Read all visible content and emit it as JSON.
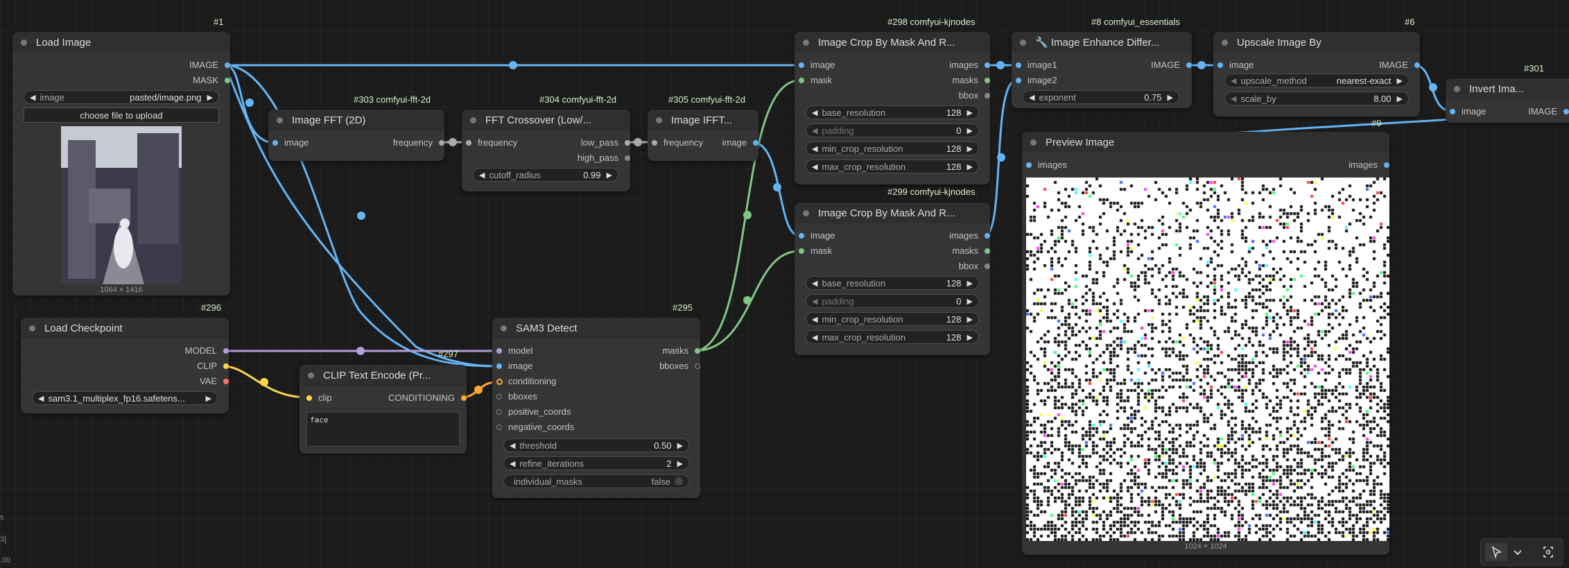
{
  "badges": {
    "n1": "#1",
    "n296": "#296",
    "n297": "#297",
    "n303": "#303 comfyui-fft-2d",
    "n304": "#304 comfyui-fft-2d",
    "n305": "#305 comfyui-fft-2d",
    "n295": "#295",
    "n298": "#298 comfyui-kjnodes",
    "n299": "#299 comfyui-kjnodes",
    "n8": "#8 comfyui_essentials",
    "n6": "#6",
    "n301": "#301",
    "n9": "#9"
  },
  "load_image": {
    "title": "Load Image",
    "out_image": "IMAGE",
    "out_mask": "MASK",
    "widget_label": "image",
    "widget_value": "pasted/image.png",
    "upload_button": "choose file to upload",
    "size_caption": "1064 × 1416"
  },
  "load_checkpoint": {
    "title": "Load Checkpoint",
    "out_model": "MODEL",
    "out_clip": "CLIP",
    "out_vae": "VAE",
    "ckpt_value": "sam3.1_multiplex_fp16.safetens..."
  },
  "clip_text_encode": {
    "title": "CLIP Text Encode (Pr...",
    "in_clip": "clip",
    "out_conditioning": "CONDITIONING",
    "text": "face"
  },
  "fft": {
    "title": "Image FFT (2D)",
    "in_image": "image",
    "out_frequency": "frequency"
  },
  "fft_crossover": {
    "title": "FFT Crossover (Low/...",
    "in_frequency": "frequency",
    "out_low": "low_pass",
    "out_high": "high_pass",
    "cutoff_label": "cutoff_radius",
    "cutoff_value": "0.99"
  },
  "ifft": {
    "title": "Image IFFT...",
    "in_frequency": "frequency",
    "out_image": "image"
  },
  "sam3": {
    "title": "SAM3 Detect",
    "in_model": "model",
    "in_image": "image",
    "in_conditioning": "conditioning",
    "in_bboxes": "bboxes",
    "in_pos": "positive_coords",
    "in_neg": "negative_coords",
    "out_masks": "masks",
    "out_bboxes": "bboxes",
    "threshold_label": "threshold",
    "threshold_value": "0.50",
    "refine_label": "refine_iterations",
    "refine_value": "2",
    "individual_label": "individual_masks",
    "individual_value": "false"
  },
  "crop1": {
    "title": "Image Crop By Mask And R...",
    "in_image": "image",
    "in_mask": "mask",
    "out_images": "images",
    "out_masks": "masks",
    "out_bbox": "bbox",
    "w1_label": "base_resolution",
    "w1_value": "128",
    "w2_label": "padding",
    "w2_value": "0",
    "w3_label": "min_crop_resolution",
    "w3_value": "128",
    "w4_label": "max_crop_resolution",
    "w4_value": "128"
  },
  "crop2": {
    "title": "Image Crop By Mask And R...",
    "in_image": "image",
    "in_mask": "mask",
    "out_images": "images",
    "out_masks": "masks",
    "out_bbox": "bbox",
    "w1_label": "base_resolution",
    "w1_value": "128",
    "w2_label": "padding",
    "w2_value": "0",
    "w3_label": "min_crop_resolution",
    "w3_value": "128",
    "w4_label": "max_crop_resolution",
    "w4_value": "128"
  },
  "enhance": {
    "title": "🔧 Image Enhance Differ...",
    "in_image1": "image1",
    "in_image2": "image2",
    "out_image": "IMAGE",
    "exp_label": "exponent",
    "exp_value": "0.75"
  },
  "upscale": {
    "title": "Upscale Image By",
    "in_image": "image",
    "out_image": "IMAGE",
    "method_label": "upscale_method",
    "method_value": "nearest-exact",
    "scale_label": "scale_by",
    "scale_value": "8.00"
  },
  "invert": {
    "title": "Invert Ima...",
    "in_image": "image",
    "out_image": "IMAGE"
  },
  "preview": {
    "title": "Preview Image",
    "in_images": "images",
    "out_images": "images",
    "size_caption": "1024 × 1024"
  },
  "side_texts": [
    "s",
    "3]",
    ".00"
  ],
  "colors": {
    "image": "#64b5f6",
    "mask": "#81c784",
    "model": "#b39ddb",
    "clip": "#ffd54f",
    "vae": "#ff6e6e",
    "conditioning": "#ffa931"
  }
}
